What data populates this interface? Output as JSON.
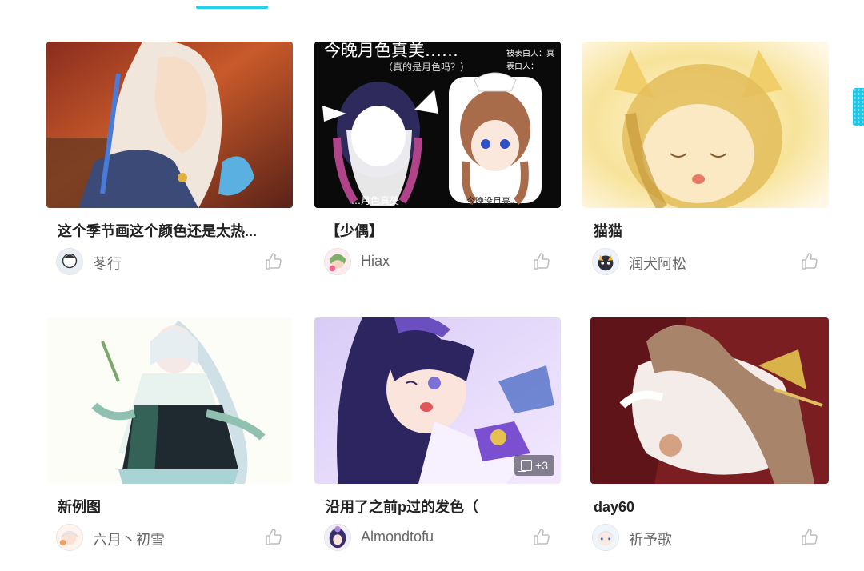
{
  "accent": "#22d3ee",
  "cards": [
    {
      "title": "这个季节画这个颜色还是太热...",
      "author": "苳行",
      "image_icon": "artwork-image",
      "like_icon": "thumb-up-icon"
    },
    {
      "title": "【少偶】",
      "author": "Hiax",
      "image_icon": "artwork-image",
      "like_icon": "thumb-up-icon",
      "overlay": {
        "line1": "今晚月色真美……",
        "line2": "（真的是月色吗？）",
        "tag1": "被表白人：冥",
        "tag2": "表白人：",
        "caption1": "…月色真美",
        "caption2": "今晚没月亮。"
      }
    },
    {
      "title": "猫猫",
      "author": "润犬阿松",
      "image_icon": "artwork-image",
      "like_icon": "thumb-up-icon"
    },
    {
      "title": "新例图",
      "author": "六月丶初雪",
      "image_icon": "artwork-image",
      "like_icon": "thumb-up-icon"
    },
    {
      "title": "沿用了之前p过的发色（",
      "author": "Almondtofu",
      "image_icon": "artwork-image",
      "like_icon": "thumb-up-icon",
      "badge": "+3"
    },
    {
      "title": "day60",
      "author": "祈予歌",
      "image_icon": "artwork-image",
      "like_icon": "thumb-up-icon"
    }
  ]
}
